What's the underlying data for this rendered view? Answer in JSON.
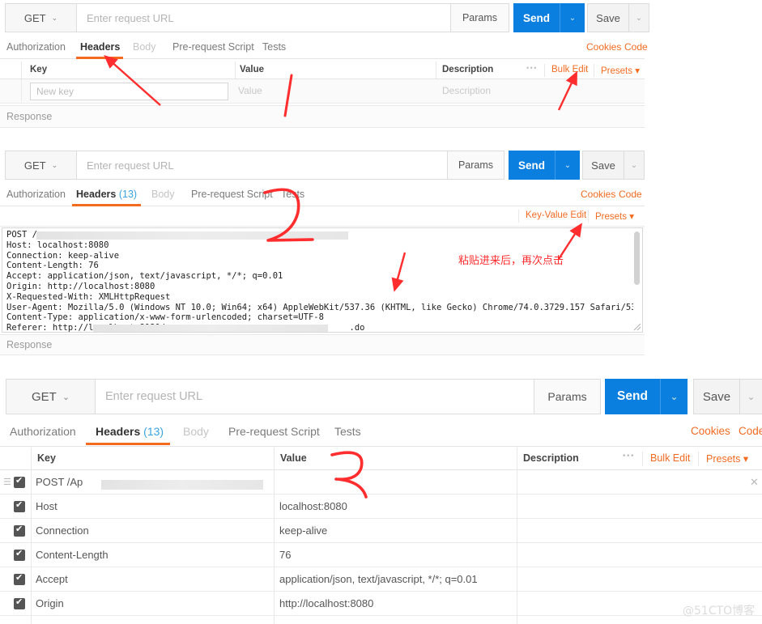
{
  "app": {
    "watermark": "@51CTO博客"
  },
  "common": {
    "method": "GET",
    "url_placeholder": "Enter request URL",
    "params_label": "Params",
    "send_label": "Send",
    "save_label": "Save",
    "caret_glyph": "⌄",
    "response_label": "Response",
    "cookies_label": "Cookies",
    "code_label": "Code",
    "presets_label": "Presets",
    "presets_caret": "▾",
    "dots_glyph": "•••",
    "close_glyph": "✕",
    "grip_glyph": "☰"
  },
  "panel1": {
    "tabs": [
      {
        "label": "Authorization",
        "state": "normal"
      },
      {
        "label": "Headers",
        "state": "active"
      },
      {
        "label": "Body",
        "state": "dim"
      },
      {
        "label": "Pre-request Script",
        "state": "normal"
      },
      {
        "label": "Tests",
        "state": "normal"
      }
    ],
    "columns": {
      "key": "Key",
      "value": "Value",
      "description": "Description"
    },
    "bulk_edit_label": "Bulk Edit",
    "new_row": {
      "key_placeholder": "New key",
      "value_placeholder": "Value",
      "description_placeholder": "Description"
    }
  },
  "panel2": {
    "tabs": [
      {
        "label": "Authorization",
        "state": "normal"
      },
      {
        "label": "Headers",
        "state": "active",
        "count": "(13)"
      },
      {
        "label": "Body",
        "state": "dim"
      },
      {
        "label": "Pre-request Script",
        "state": "normal"
      },
      {
        "label": "Tests",
        "state": "normal"
      }
    ],
    "key_value_edit_label": "Key-Value Edit",
    "raw_text": "POST /                                                                    \nHost: localhost:8080\nConnection: keep-alive\nContent-Length: 76\nAccept: application/json, text/javascript, */*; q=0.01\nOrigin: http://localhost:8080\nX-Requested-With: XMLHttpRequest\nUser-Agent: Mozilla/5.0 (Windows NT 10.0; Win64; x64) AppleWebKit/537.36 (KHTML, like Gecko) Chrome/74.0.3729.157 Safari/537.36\nContent-Type: application/x-www-form-urlencoded; charset=UTF-8\nReferer: http://localhost:8080/                                    .do\nAccept-Encoding: gzip, deflate, br"
  },
  "panel3": {
    "tabs": [
      {
        "label": "Authorization",
        "state": "normal"
      },
      {
        "label": "Headers",
        "state": "active",
        "count": "(13)"
      },
      {
        "label": "Body",
        "state": "dim"
      },
      {
        "label": "Pre-request Script",
        "state": "normal"
      },
      {
        "label": "Tests",
        "state": "normal"
      }
    ],
    "columns": {
      "key": "Key",
      "value": "Value",
      "description": "Description"
    },
    "bulk_edit_label": "Bulk Edit",
    "rows": [
      {
        "key": "POST /Ap",
        "value": "",
        "checked": true,
        "redacted": true
      },
      {
        "key": "Host",
        "value": "localhost:8080",
        "checked": true,
        "redacted": false
      },
      {
        "key": "Connection",
        "value": "keep-alive",
        "checked": true,
        "redacted": false
      },
      {
        "key": "Content-Length",
        "value": "76",
        "checked": true,
        "redacted": false
      },
      {
        "key": "Accept",
        "value": "application/json, text/javascript, */*; q=0.01",
        "checked": true,
        "redacted": false
      },
      {
        "key": "Origin",
        "value": "http://localhost:8080",
        "checked": true,
        "redacted": false
      }
    ]
  },
  "annotations": {
    "step1": "1",
    "step2": "2",
    "step3": "3",
    "chinese_note": "粘贴进来后，再次点击",
    "accent_red": "#ff2d2d",
    "accent_orange": "#f26b21",
    "accent_blue": "#0b7fe0"
  }
}
